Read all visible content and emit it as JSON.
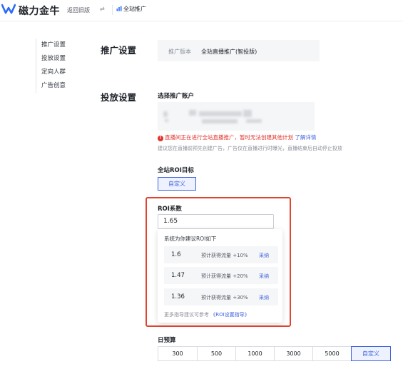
{
  "topbar": {
    "brand": "磁力金牛",
    "back_label": "返回旧版",
    "swap_glyph": "⇄",
    "current_tab": "全站推广"
  },
  "sidenav": {
    "items": [
      {
        "label": "推广设置"
      },
      {
        "label": "投放设置"
      },
      {
        "label": "定向人群"
      },
      {
        "label": "广告创意"
      }
    ]
  },
  "promo_settings": {
    "title": "推广设置",
    "version_label": "推广版本",
    "version_value": "全站直播推广(智投版)"
  },
  "delivery_settings": {
    "title": "投放设置",
    "account_label": "选择推广账户",
    "warning_icon": "!",
    "warning_text": "直播间正在进行全站直播推广，暂时无法创建其他计划",
    "warning_link": "了解详情",
    "hint": "建议您在直播前预先创建广告，广告仅在直播进行时曝光，直播结束后自动停止投放",
    "roi_goal_label": "全站ROI目标",
    "roi_goal_button": "自定义",
    "roi_coef_label": "ROI系数",
    "roi_value": "1.65",
    "suggest_title": "系统为你建议ROI如下",
    "suggestions": [
      {
        "value": "1.6",
        "desc": "预计获得流量 +10%",
        "action": "采纳"
      },
      {
        "value": "1.47",
        "desc": "预计获得流量 +20%",
        "action": "采纳"
      },
      {
        "value": "1.36",
        "desc": "预计获得流量 +30%",
        "action": "采纳"
      }
    ],
    "guide_text": "更多指导建议可参考",
    "guide_link": "《ROI设置指导》",
    "budget_label": "日预算",
    "budget_options": [
      "300",
      "500",
      "1000",
      "3000",
      "5000",
      "自定义"
    ],
    "budget_selected": "自定义"
  },
  "colors": {
    "accent": "#3e63dd",
    "warning": "#e0322b",
    "highlight": "#e0442f",
    "panel_bg": "#f5f6f8"
  }
}
